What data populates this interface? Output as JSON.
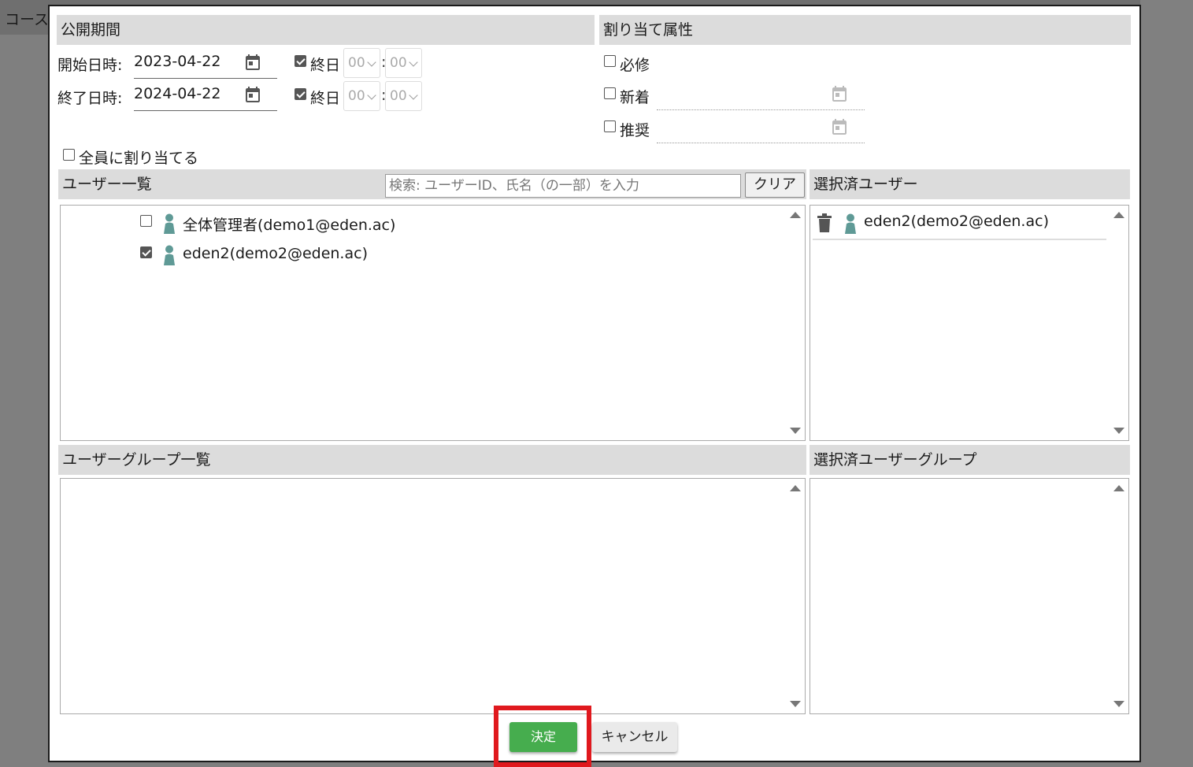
{
  "background": {
    "title": "コース"
  },
  "period": {
    "heading": "公開期間",
    "start_label": "開始日時:",
    "start_date": "2023-04-22",
    "end_label": "終了日時:",
    "end_date": "2024-04-22",
    "allday_label": "終日",
    "start_allday_checked": true,
    "end_allday_checked": true,
    "hour_value": "00",
    "minute_value": "00",
    "colon": ":"
  },
  "attributes": {
    "heading": "割り当て属性",
    "required_label": "必修",
    "new_label": "新着",
    "recommended_label": "推奨"
  },
  "assign_all_label": "全員に割り当てる",
  "user_list": {
    "heading": "ユーザー一覧",
    "search_placeholder": "検索: ユーザーID、氏名（の一部）を入力",
    "clear_label": "クリア",
    "users": [
      {
        "name": "全体管理者(demo1@eden.ac)",
        "checked": false
      },
      {
        "name": "eden2(demo2@eden.ac)",
        "checked": true
      }
    ]
  },
  "selected_users": {
    "heading": "選択済ユーザー",
    "users": [
      {
        "name": "eden2(demo2@eden.ac)"
      }
    ]
  },
  "group_list": {
    "heading": "ユーザーグループ一覧"
  },
  "selected_groups": {
    "heading": "選択済ユーザーグループ"
  },
  "actions": {
    "ok_label": "決定",
    "cancel_label": "キャンセル"
  },
  "colors": {
    "ok_button": "#46ad4e",
    "highlight": "#e0191e",
    "person_icon": "#5f9a96"
  },
  "icons": [
    "calendar-icon",
    "person-icon",
    "trash-icon",
    "chevron-down-icon",
    "scroll-up-icon",
    "scroll-down-icon"
  ]
}
